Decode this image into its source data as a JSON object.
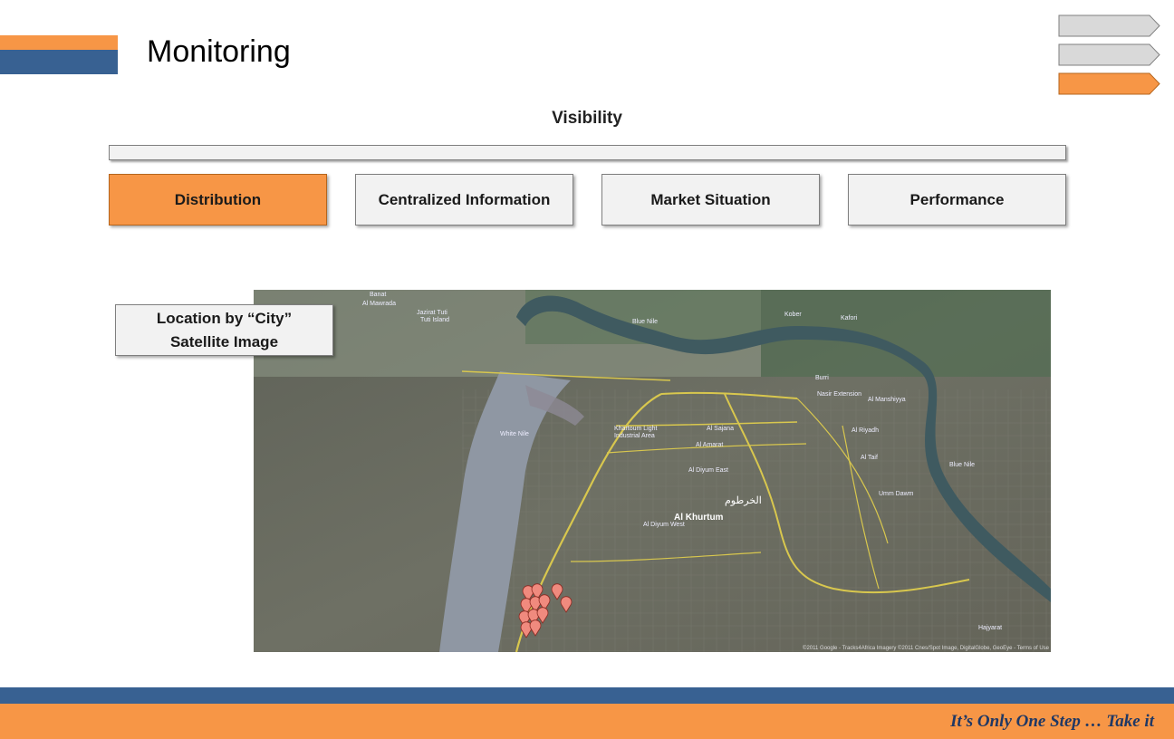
{
  "header": {
    "title": "Monitoring",
    "brand_colors": {
      "orange": "#F79646",
      "blue": "#386192"
    }
  },
  "steps": [
    {
      "state": "inactive",
      "color": "#d9d9d9"
    },
    {
      "state": "inactive",
      "color": "#d9d9d9"
    },
    {
      "state": "active",
      "color": "#F79646"
    }
  ],
  "section": {
    "title": "Visibility"
  },
  "tabs": [
    {
      "label": "Distribution",
      "active": true
    },
    {
      "label": "Centralized Information",
      "active": false
    },
    {
      "label": "Market Situation",
      "active": false
    },
    {
      "label": "Performance",
      "active": false
    }
  ],
  "map_panel": {
    "label_line1": "Location by “City”",
    "label_line2": "Satellite Image",
    "map_text": {
      "white_nile": "White Nile",
      "blue_nile": "Blue Nile",
      "blue_nile_east": "Blue Nile",
      "khartoum": "Al Khurtum",
      "khartoum_arabic": "الخرطوم",
      "jazirat_tuti": "Jazirat Tuti",
      "tuti_island": "Tuti Island",
      "al_mawrada": "Al Mawrada",
      "banat": "Banat",
      "kober": "Kober",
      "kafori": "Kafori",
      "umm_dawm": "Umm Dawm",
      "al_riyadh": "Al Riyadh",
      "al_manshiyya": "Al Manshiyya",
      "al_amarat": "Al Amarat",
      "al_sajana": "Al Sajana",
      "industrial": "Khartoum Light Industrial Area",
      "al_diyum_east": "Al Diyum East",
      "al_diyum_west": "Al Diyum West",
      "burri": "Burri",
      "al_taif": "Al Taif",
      "nasir": "Nasir Extension",
      "hajyarat": "Hajyarat",
      "attribution": "©2011 Google - Tracks4Africa Imagery ©2011 Cnes/Spot Image, DigitalGlobe, GeoEye - Terms of Use"
    },
    "marker_color": "#F08A7E"
  },
  "footer": {
    "tagline": "It’s Only One Step … Take it"
  }
}
